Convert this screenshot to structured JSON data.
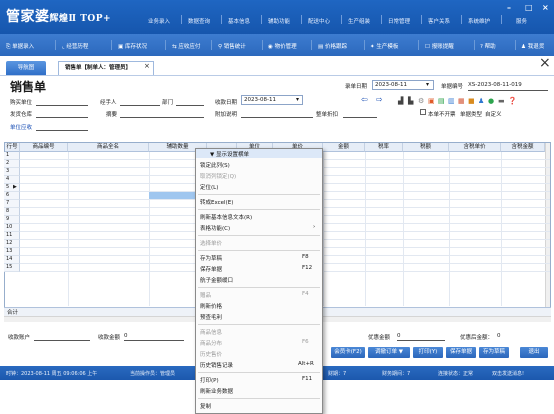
{
  "app": {
    "logo_main": "管家婆",
    "logo_sub": "辉煌Ⅱ TOP+",
    "top_menu": [
      "业务录入",
      "数据查询",
      "基本信息",
      "辅助功能",
      "配送中心",
      "生产组装",
      "日常管理",
      "客户关系",
      "系统维护",
      "服务"
    ],
    "window_buttons": [
      "–",
      "□",
      "×"
    ]
  },
  "toolbar": {
    "items": [
      "单据录入",
      "经营历程",
      "库存状况",
      "应收应付",
      "销售统计",
      "物价管理",
      "价格跟踪",
      "生产模板",
      "报账提醒",
      "帮助",
      "我退货"
    ]
  },
  "tabs": {
    "nav": "导航图",
    "sales": "销售单【制单人：管理员】",
    "close": "×",
    "window_close": "×"
  },
  "form": {
    "title": "销售单",
    "entry_date_label": "录单日期",
    "entry_date": "2023-08-11",
    "doc_no_label": "单据编号",
    "doc_no": "XS-2023-08-11-019",
    "buyer_label": "购买单位",
    "handler_label": "经手人",
    "dept_label": "部门",
    "pay_date_label": "收款日期",
    "pay_date": "2023-08-11",
    "warehouse_label": "发货仓库",
    "summary_label": "摘要",
    "note_label": "附加说明",
    "discount_label": "整单折扣",
    "no_invoice_label": "本单不开票",
    "doc_type_label": "单据类型",
    "doc_type_value": "自定义",
    "unit_code_label": "单位应收"
  },
  "grid": {
    "columns": [
      "行号",
      "商品编号",
      "商品全名",
      "辅助数量",
      "",
      "单位",
      "单价",
      "金额",
      "税率",
      "税额",
      "含税单价",
      "含税金额"
    ],
    "rows": [
      "1",
      "2",
      "3",
      "4",
      "5",
      "6",
      "7",
      "8",
      "9",
      "10",
      "11",
      "12",
      "13",
      "14",
      "15"
    ],
    "current_row_marker": "▶",
    "sum_label": "合计"
  },
  "context_menu": {
    "items": [
      {
        "label": "▼ 显示设置横单",
        "key": "",
        "disabled": false
      },
      {
        "label": "锁定此列(S)",
        "key": "",
        "disabled": false
      },
      {
        "label": "取消列锁定(Q)",
        "key": "",
        "disabled": true
      },
      {
        "label": "定位(L)",
        "key": "",
        "disabled": false
      },
      {
        "label": "转成Excel(E)",
        "key": "",
        "disabled": false
      },
      {
        "label": "刷新基本信息文本(R)",
        "key": "",
        "disabled": false
      },
      {
        "label": "表格功能(C)",
        "key": "›",
        "disabled": false
      },
      {
        "label": "选择单价",
        "key": "",
        "disabled": true
      },
      {
        "label": "存为草稿",
        "key": "F8",
        "disabled": false
      },
      {
        "label": "保存单据",
        "key": "F12",
        "disabled": false
      },
      {
        "label": "航子金额缓口",
        "key": "",
        "disabled": false
      },
      {
        "label": "赠品",
        "key": "F4",
        "disabled": true
      },
      {
        "label": "刷新价格",
        "key": "",
        "disabled": false
      },
      {
        "label": "预查毛利",
        "key": "",
        "disabled": false
      },
      {
        "label": "商品信息",
        "key": "",
        "disabled": true
      },
      {
        "label": "商品分布",
        "key": "F6",
        "disabled": true
      },
      {
        "label": "历史售价",
        "key": "",
        "disabled": true
      },
      {
        "label": "历史销售记录",
        "key": "Alt+R",
        "disabled": false
      },
      {
        "label": "打印(P)",
        "key": "F11",
        "disabled": false
      },
      {
        "label": "刷新业务数据",
        "key": "",
        "disabled": false
      },
      {
        "label": "复制",
        "key": "",
        "disabled": false
      }
    ]
  },
  "bottom": {
    "account_label": "收款账户",
    "amount_label": "收款金额",
    "amount_value": "0",
    "discount_amount_label": "优惠金额",
    "discount_amount_value": "0",
    "after_discount_label": "优惠后金额：",
    "after_discount_value": "0",
    "buttons": [
      "会员卡(F2)",
      "调撤订单 ▼",
      "打印(Y)",
      "保存单据",
      "存为草稿",
      "退出"
    ]
  },
  "status": {
    "time": "时钟：2023-08-11 周五 09:06:06 上午",
    "operator": "当前操作员：管理员",
    "period": "财期：7",
    "finance_period": "财务期间：7",
    "conn": "连接状态：正常",
    "msg": "双击发送消息!"
  },
  "colors": {
    "title_blue": "#1f66c2",
    "toolbar_blue": "#2c69bd",
    "row_highlight": "#9fc6ef"
  }
}
